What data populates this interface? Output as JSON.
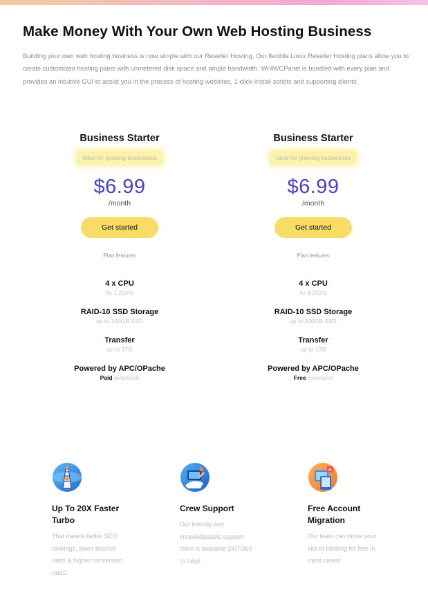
{
  "page": {
    "title": "Make Money With Your Own Web Hosting Business",
    "intro": "Building your own web hosting business is now simple with our Reseller Hosting. Our flexible Linux Reseller Hosting plans allow you to create customized hosting plans with unmetered disk space and ample bandwidth. WHM/CPanel is bundled with every plan and provides an intuitive GUI to assist you in the process of hosting websites, 1-click-install scripts and supporting clients."
  },
  "plans": [
    {
      "name": "Business Starter",
      "tagline": "Ideal for growing businesses",
      "price": "$6.99",
      "period": "/month",
      "cta": "Get started",
      "features_label": "Plan features",
      "features": [
        {
          "title": "4 x CPU",
          "sub": "4x 1.2GHz"
        },
        {
          "title": "RAID-10 SSD Storage",
          "sub": "up to 150GB SSD"
        },
        {
          "title": "Transfer",
          "sub": "up to 1TB"
        },
        {
          "title": "Powered by APC/OPache",
          "sub_strong": "Paid",
          "sub": "extension"
        }
      ]
    },
    {
      "name": "Business Starter",
      "tagline": "Ideal for growing businesses",
      "price": "$6.99",
      "period": "/month",
      "cta": "Get started",
      "features_label": "Plan features",
      "features": [
        {
          "title": "4 x CPU",
          "sub": "4x 4.2GHz"
        },
        {
          "title": "RAID-10 SSD Storage",
          "sub": "up to 300GB SSD"
        },
        {
          "title": "Transfer",
          "sub": "up to 1TB"
        },
        {
          "title": "Powered by APC/OPache",
          "sub_strong": "Free",
          "sub": "extension"
        }
      ]
    }
  ],
  "benefits": [
    {
      "icon": "turbo-tower-icon",
      "title": "Up To 20X Faster Turbo",
      "desc": "That means better SEO rankings, lower bounce rates & higher conversion rates."
    },
    {
      "icon": "support-icon",
      "title": "Crew Support",
      "desc": "Our friendly and knowledgeable support team is available 24/7/365 to help!"
    },
    {
      "icon": "migration-icon",
      "title": "Free Account Migration",
      "desc": "Our team can move your site to Hosting for free in most cases!"
    }
  ],
  "colors": {
    "accent": "#4a3fd4",
    "button": "#f7dc66",
    "highlight": "#fbf3a9"
  }
}
